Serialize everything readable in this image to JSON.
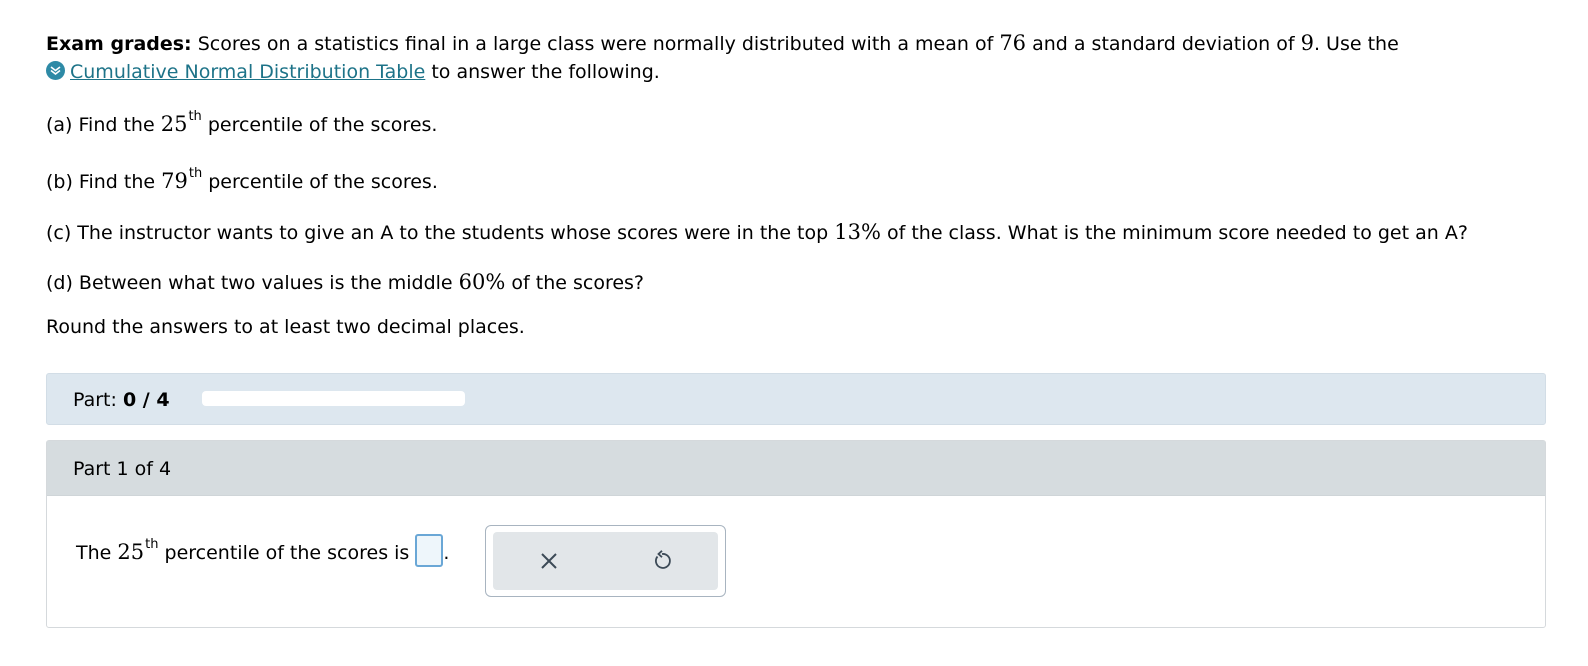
{
  "problem": {
    "title": "Exam grades:",
    "intro_1": "Scores on a statistics final in a large class were normally distributed with a mean of",
    "mean": "76",
    "intro_2": "and a standard deviation of",
    "sd": "9",
    "intro_3": ". Use the",
    "table_link": "Cumulative Normal Distribution Table",
    "intro_4": "to answer the following."
  },
  "questions": {
    "a": {
      "pre": "(a) Find the",
      "num": "25",
      "sup": "th",
      "post": "percentile of the scores."
    },
    "b": {
      "pre": "(b) Find the",
      "num": "79",
      "sup": "th",
      "post": "percentile of the scores."
    },
    "c": {
      "pre": "(c) The instructor wants to give an A to the students whose scores were in the top",
      "num": "13%",
      "post": "of the class. What is the minimum score needed to get an A?"
    },
    "d": {
      "pre": "(d) Between what two values is the middle",
      "num": "60%",
      "post": "of the scores?"
    }
  },
  "instructions": "Round the answers to at least two decimal places.",
  "progress": {
    "label": "Part:",
    "value": "0 / 4",
    "fraction": 0
  },
  "part": {
    "header": "Part 1 of 4",
    "answer_pre": "The",
    "answer_num": "25",
    "answer_sup": "th",
    "answer_post": "percentile of the scores is",
    "answer_end": ".",
    "answer_value": ""
  },
  "tools": {
    "clear_icon": "close-icon",
    "undo_icon": "undo-icon"
  },
  "colors": {
    "link": "#1d7388",
    "progress_panel": "#dde7ef",
    "part_header": "#d6dcdf",
    "input_border": "#6aa7d6"
  }
}
